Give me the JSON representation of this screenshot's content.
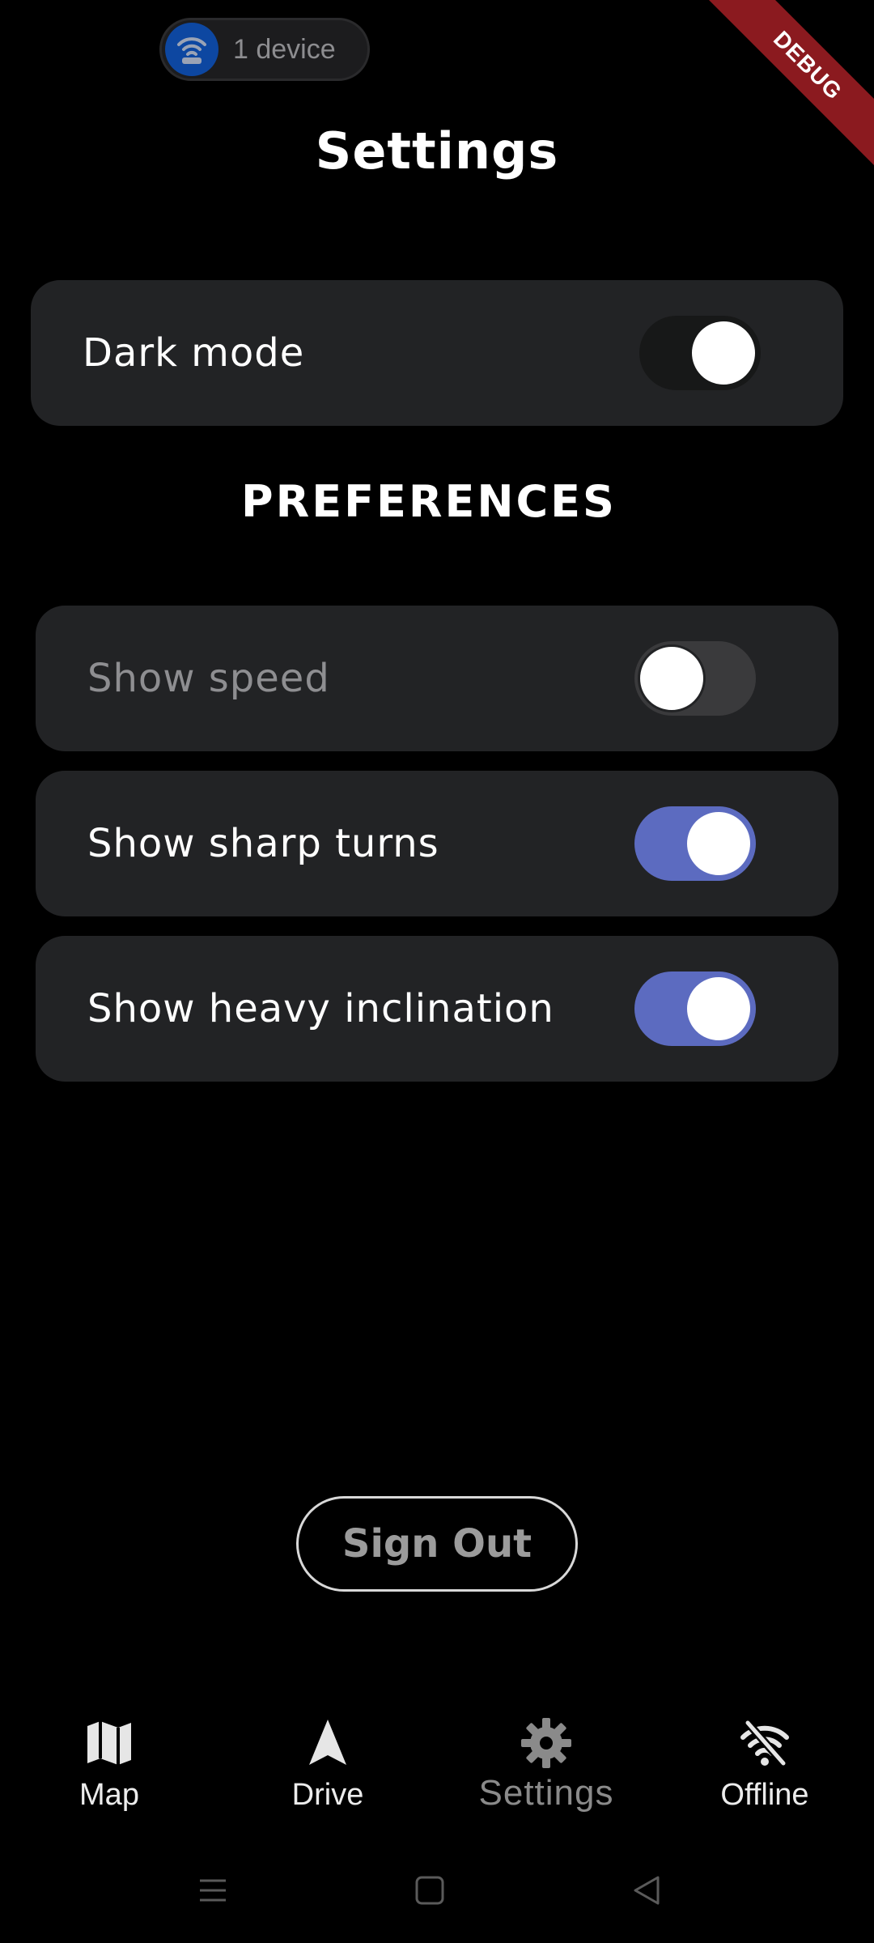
{
  "status": {
    "device_count_label": "1 device",
    "debug_banner": "DEBUG"
  },
  "page": {
    "title": "Settings"
  },
  "dark_mode": {
    "label": "Dark mode",
    "enabled": true
  },
  "preferences": {
    "heading": "PREFERENCES",
    "items": [
      {
        "label": "Show speed",
        "enabled": false
      },
      {
        "label": "Show sharp turns",
        "enabled": true
      },
      {
        "label": "Show heavy inclination",
        "enabled": true
      }
    ]
  },
  "actions": {
    "sign_out_label": "Sign Out"
  },
  "bottom_nav": {
    "items": [
      {
        "label": "Map",
        "icon": "map-icon",
        "active": false
      },
      {
        "label": "Drive",
        "icon": "navigation-arrow-icon",
        "active": false
      },
      {
        "label": "Settings",
        "icon": "gear-icon",
        "active": true
      },
      {
        "label": "Offline",
        "icon": "wifi-off-icon",
        "active": false
      }
    ]
  },
  "colors": {
    "background": "#000000",
    "card": "#222325",
    "accent": "#5c6bc0",
    "switch_off_track": "#3a3a3c",
    "switch_dark_track": "#171818",
    "debug_ribbon": "#8b1a1f",
    "device_badge": "#0d47a1"
  }
}
